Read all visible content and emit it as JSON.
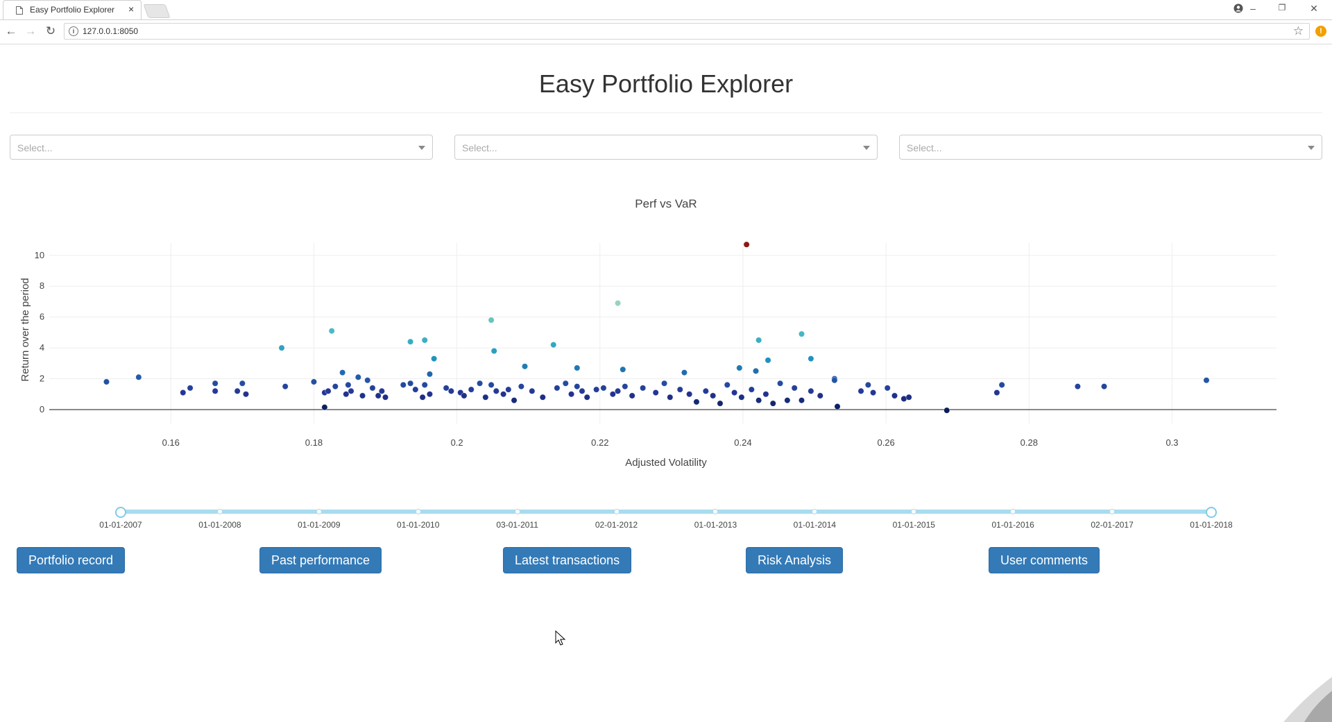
{
  "browser": {
    "tab_title": "Easy Portfolio Explorer",
    "tab_close": "×",
    "url": "127.0.0.1:8050",
    "update_badge": "!",
    "icons": [
      "page-icon",
      "back-icon",
      "forward-icon",
      "reload-icon",
      "info-icon",
      "star-icon",
      "account-icon",
      "minimize-icon",
      "restore-icon",
      "close-icon"
    ]
  },
  "app": {
    "title": "Easy Portfolio Explorer",
    "dropdowns": [
      {
        "placeholder": "Select..."
      },
      {
        "placeholder": "Select..."
      },
      {
        "placeholder": "Select..."
      }
    ],
    "slider": {
      "labels": [
        "01-01-2007",
        "01-01-2008",
        "01-01-2009",
        "01-01-2010",
        "03-01-2011",
        "02-01-2012",
        "01-01-2013",
        "01-01-2014",
        "01-01-2015",
        "01-01-2016",
        "02-01-2017",
        "01-01-2018"
      ],
      "selected_start": "01-01-2007",
      "selected_end": "01-01-2018",
      "track_color": "#a8dcef"
    },
    "buttons": [
      "Portfolio record",
      "Past performance",
      "Latest transactions",
      "Risk Analysis",
      "User comments"
    ],
    "button_color": "#337ab7"
  },
  "chart_data": {
    "type": "scatter",
    "title": "Perf vs VaR",
    "xlabel": "Adjusted Volatility",
    "ylabel": "Return over the period",
    "xlim": [
      0.143,
      0.3146
    ],
    "ylim": [
      -0.9,
      10.8
    ],
    "xticks": [
      0.16,
      0.18,
      0.2,
      0.22,
      0.24,
      0.26,
      0.28,
      0.3
    ],
    "xtick_labels": [
      "0.16",
      "0.18",
      "0.2",
      "0.22",
      "0.24",
      "0.26",
      "0.28",
      "0.3"
    ],
    "yticks": [
      0,
      2,
      4,
      6,
      8,
      10
    ],
    "ytick_labels": [
      "0",
      "2",
      "4",
      "6",
      "8",
      "10"
    ],
    "grid": true,
    "colorscale": "YlGnBu (color by return; highest value dark red)",
    "x": [
      0.151,
      0.1555,
      0.1617,
      0.1627,
      0.1662,
      0.1662,
      0.1693,
      0.17,
      0.1705,
      0.176,
      0.18,
      0.1815,
      0.182,
      0.183,
      0.184,
      0.1845,
      0.1848,
      0.1852,
      0.1862,
      0.1868,
      0.1875,
      0.1882,
      0.189,
      0.1895,
      0.19,
      0.1925,
      0.1935,
      0.1942,
      0.1952,
      0.1955,
      0.1962,
      0.1985,
      0.1992,
      0.2005,
      0.201,
      0.202,
      0.2032,
      0.204,
      0.2048,
      0.2055,
      0.2065,
      0.2072,
      0.208,
      0.209,
      0.2105,
      0.212,
      0.214,
      0.2152,
      0.216,
      0.2168,
      0.2175,
      0.2182,
      0.2195,
      0.2205,
      0.2218,
      0.2225,
      0.2235,
      0.2245,
      0.226,
      0.2278,
      0.229,
      0.2298,
      0.2312,
      0.2325,
      0.2335,
      0.2348,
      0.2358,
      0.2368,
      0.2378,
      0.2388,
      0.2398,
      0.2412,
      0.2422,
      0.2432,
      0.2442,
      0.2452,
      0.2462,
      0.2472,
      0.2482,
      0.2495,
      0.2508,
      0.2532,
      0.2565,
      0.2575,
      0.2582,
      0.2602,
      0.2612,
      0.2625,
      0.2632,
      0.2755,
      0.2762,
      0.2868,
      0.2905,
      0.3048,
      0.1815,
      0.2685,
      0.2528,
      0.1755,
      0.1825,
      0.1935,
      0.1955,
      0.2048,
      0.2052,
      0.2225,
      0.2405,
      0.2135,
      0.2482,
      0.1968,
      0.2422,
      0.2495,
      0.2395,
      0.2168,
      0.2095,
      0.1962,
      0.2318,
      0.2232,
      0.2435,
      0.2418,
      0.2528
    ],
    "y": [
      1.8,
      2.1,
      1.1,
      1.4,
      1.7,
      1.2,
      1.2,
      1.7,
      1.0,
      1.5,
      1.8,
      1.1,
      1.2,
      1.5,
      2.4,
      1.0,
      1.6,
      1.2,
      2.1,
      0.9,
      1.9,
      1.4,
      0.9,
      1.2,
      0.8,
      1.6,
      1.7,
      1.3,
      0.8,
      1.6,
      1.0,
      1.4,
      1.2,
      1.1,
      0.9,
      1.3,
      1.7,
      0.8,
      1.6,
      1.2,
      1.0,
      1.3,
      0.6,
      1.5,
      1.2,
      0.8,
      1.4,
      1.7,
      1.0,
      1.5,
      1.2,
      0.8,
      1.3,
      1.4,
      1.0,
      1.2,
      1.5,
      0.9,
      1.4,
      1.1,
      1.7,
      0.8,
      1.3,
      1.0,
      0.5,
      1.2,
      0.9,
      0.4,
      1.6,
      1.1,
      0.8,
      1.3,
      0.6,
      1.0,
      0.4,
      1.7,
      0.6,
      1.4,
      0.6,
      1.2,
      0.9,
      0.2,
      1.2,
      1.6,
      1.1,
      1.4,
      0.9,
      0.7,
      0.8,
      1.1,
      1.6,
      1.5,
      1.5,
      1.9,
      0.15,
      -0.05,
      2.0,
      4.0,
      5.1,
      4.4,
      4.5,
      5.8,
      3.8,
      6.9,
      10.7,
      4.2,
      4.9,
      3.3,
      4.5,
      3.3,
      2.7,
      2.7,
      2.8,
      2.3,
      2.4,
      2.6,
      3.2,
      2.5,
      1.9
    ]
  }
}
